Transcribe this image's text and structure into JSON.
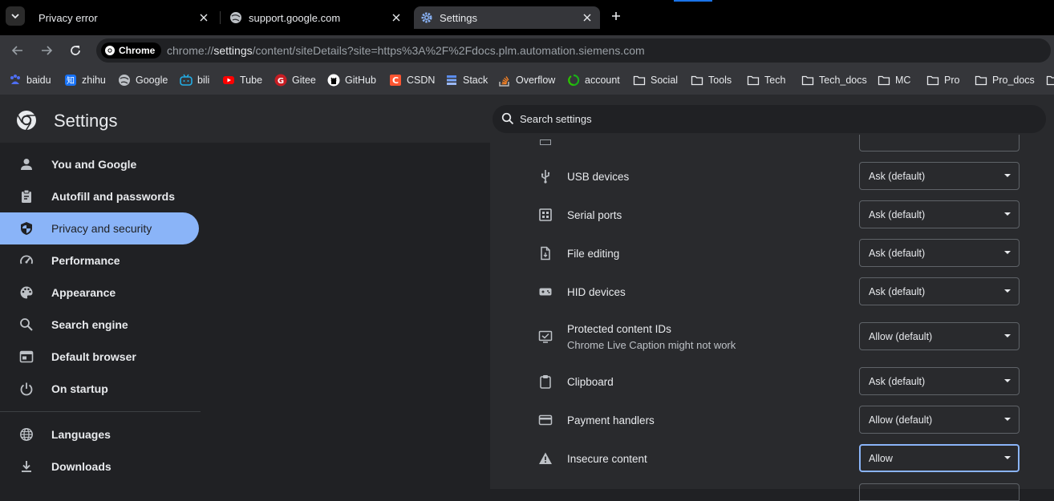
{
  "tabs": [
    {
      "title": "Privacy error",
      "icon": "warning-icon"
    },
    {
      "title": "support.google.com",
      "icon": "globe-icon"
    },
    {
      "title": "Settings",
      "icon": "gear-icon"
    }
  ],
  "omnibox": {
    "chip_label": "Chrome",
    "url_prefix": "chrome://",
    "url_host": "settings",
    "url_path": "/content/siteDetails?site=https%3A%2F%2Fdocs.plm.automation.siemens.com"
  },
  "bookmarks": [
    {
      "label": "baidu",
      "icon": "baidu-icon"
    },
    {
      "label": "zhihu",
      "icon": "zhihu-icon"
    },
    {
      "label": "Google",
      "icon": "globe-icon"
    },
    {
      "label": "bili",
      "icon": "bilibili-icon"
    },
    {
      "label": "Tube",
      "icon": "youtube-icon"
    },
    {
      "label": "Gitee",
      "icon": "gitee-icon"
    },
    {
      "label": "GitHub",
      "icon": "github-icon"
    },
    {
      "label": "CSDN",
      "icon": "csdn-icon"
    },
    {
      "label": "Stack",
      "icon": "stack-icon"
    },
    {
      "label": "Overflow",
      "icon": "stackoverflow-icon"
    },
    {
      "label": "account",
      "icon": "account-icon"
    },
    {
      "label": "Social",
      "icon": "folder-icon"
    },
    {
      "label": "Tools",
      "icon": "folder-icon"
    },
    {
      "label": "Tech",
      "icon": "folder-icon"
    },
    {
      "label": "Tech_docs",
      "icon": "folder-icon"
    },
    {
      "label": "MC",
      "icon": "folder-icon"
    },
    {
      "label": "Pro",
      "icon": "folder-icon"
    },
    {
      "label": "Pro_docs",
      "icon": "folder-icon"
    }
  ],
  "header": {
    "title": "Settings",
    "search_placeholder": "Search settings"
  },
  "sidebar": {
    "items": [
      {
        "label": "You and Google",
        "icon": "person-icon"
      },
      {
        "label": "Autofill and passwords",
        "icon": "clipboard-icon"
      },
      {
        "label": "Privacy and security",
        "icon": "shield-icon",
        "active": true
      },
      {
        "label": "Performance",
        "icon": "speedometer-icon"
      },
      {
        "label": "Appearance",
        "icon": "palette-icon"
      },
      {
        "label": "Search engine",
        "icon": "search-icon"
      },
      {
        "label": "Default browser",
        "icon": "browser-icon"
      },
      {
        "label": "On startup",
        "icon": "power-icon"
      },
      {
        "label": "Languages",
        "icon": "globe-icon"
      },
      {
        "label": "Downloads",
        "icon": "download-icon"
      }
    ]
  },
  "permissions": [
    {
      "label": "USB devices",
      "value": "Ask (default)",
      "icon": "usb-icon"
    },
    {
      "label": "Serial ports",
      "value": "Ask (default)",
      "icon": "serial-port-icon"
    },
    {
      "label": "File editing",
      "value": "Ask (default)",
      "icon": "file-edit-icon"
    },
    {
      "label": "HID devices",
      "value": "Ask (default)",
      "icon": "gamepad-icon"
    },
    {
      "label": "Protected content IDs",
      "sublabel": "Chrome Live Caption might not work",
      "value": "Allow (default)",
      "icon": "protected-content-icon"
    },
    {
      "label": "Clipboard",
      "value": "Ask (default)",
      "icon": "clipboard-icon"
    },
    {
      "label": "Payment handlers",
      "value": "Allow (default)",
      "icon": "credit-card-icon"
    },
    {
      "label": "Insecure content",
      "value": "Allow",
      "icon": "warning-icon",
      "focused": true
    }
  ],
  "colors": {
    "accent": "#8ab4f8",
    "background": "#202124",
    "card": "#292a2d"
  }
}
